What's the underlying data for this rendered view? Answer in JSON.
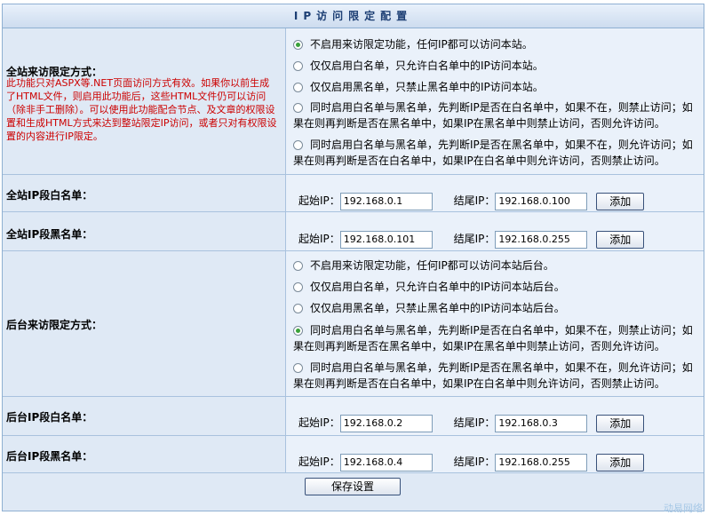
{
  "title": "IP访问限定配置",
  "site_access": {
    "label": "全站来访限定方式：",
    "description": "此功能只对ASPX等.NET页面访问方式有效。如果你以前生成了HTML文件，则启用此功能后，这些HTML文件仍可以访问（除非手工删除）。可以使用此功能配合节点、及文章的权限设置和生成HTML方式来达到整站限定IP访问，或者只对有权限设置的内容进行IP限定。",
    "options": [
      {
        "line1": "不启用来访限定功能，任何IP都可以访问本站。",
        "line2": "",
        "checked": true
      },
      {
        "line1": "仅仅启用白名单，只允许白名单中的IP访问本站。",
        "line2": "",
        "checked": false
      },
      {
        "line1": "仅仅启用黑名单，只禁止黑名单中的IP访问本站。",
        "line2": "",
        "checked": false
      },
      {
        "line1": "同时启用白名单与黑名单，先判断IP是否在白名单中，如果不在，则禁止访问；如",
        "line2": "果在则再判断是否在黑名单中，如果IP在黑名单中则禁止访问，否则允许访问。",
        "checked": false
      },
      {
        "line1": "同时启用白名单与黑名单，先判断IP是否在黑名单中，如果不在，则允许访问；如",
        "line2": "果在则再判断是否在白名单中，如果IP在白名单中则允许访问，否则禁止访问。",
        "checked": false
      }
    ]
  },
  "site_white": {
    "label": "全站IP段白名单：",
    "start_label": "起始IP：",
    "start_value": "192.168.0.1",
    "end_label": "结尾IP：",
    "end_value": "192.168.0.100",
    "add_label": "添加"
  },
  "site_black": {
    "label": "全站IP段黑名单：",
    "start_label": "起始IP：",
    "start_value": "192.168.0.101",
    "end_label": "结尾IP：",
    "end_value": "192.168.0.255",
    "add_label": "添加"
  },
  "admin_access": {
    "label": "后台来访限定方式：",
    "options": [
      {
        "line1": "不启用来访限定功能，任何IP都可以访问本站后台。",
        "line2": "",
        "checked": false
      },
      {
        "line1": "仅仅启用白名单，只允许白名单中的IP访问本站后台。",
        "line2": "",
        "checked": false
      },
      {
        "line1": "仅仅启用黑名单，只禁止黑名单中的IP访问本站后台。",
        "line2": "",
        "checked": false
      },
      {
        "line1": "同时启用白名单与黑名单，先判断IP是否在白名单中，如果不在，则禁止访问；如",
        "line2": "果在则再判断是否在黑名单中，如果IP在黑名单中则禁止访问，否则允许访问。",
        "checked": true
      },
      {
        "line1": "同时启用白名单与黑名单，先判断IP是否在黑名单中，如果不在，则允许访问；如",
        "line2": "果在则再判断是否在白名单中，如果IP在白名单中则允许访问，否则禁止访问。",
        "checked": false
      }
    ]
  },
  "admin_white": {
    "label": "后台IP段白名单：",
    "start_label": "起始IP：",
    "start_value": "192.168.0.2",
    "end_label": "结尾IP：",
    "end_value": "192.168.0.3",
    "add_label": "添加"
  },
  "admin_black": {
    "label": "后台IP段黑名单：",
    "start_label": "起始IP：",
    "start_value": "192.168.0.4",
    "end_label": "结尾IP：",
    "end_value": "192.168.0.255",
    "add_label": "添加"
  },
  "save_label": "保存设置",
  "watermark": "动易网络"
}
